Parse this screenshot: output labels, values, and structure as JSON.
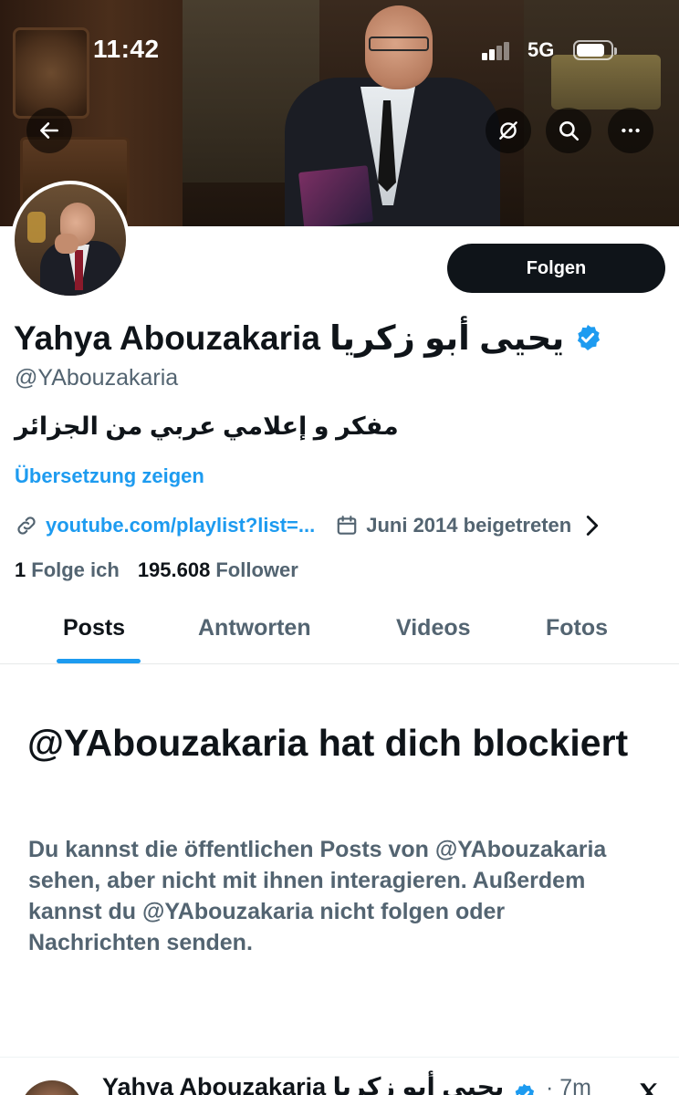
{
  "status_bar": {
    "time": "11:42",
    "network": "5G"
  },
  "banner": {
    "description_icons": [
      "back-arrow-icon",
      "hide-icon",
      "search-icon",
      "more-icon"
    ]
  },
  "profile": {
    "display_name": "Yahya Abouzakaria يحيى أبو زكريا",
    "handle": "@YAbouzakaria",
    "bio": "مفكر و إعلامي عربي من الجزائر",
    "translate_label": "Übersetzung zeigen",
    "link": "youtube.com/playlist?list=...",
    "joined": "Juni 2014 beigetreten",
    "following_count": "1",
    "following_label": "Folge ich",
    "followers_count": "195.608",
    "followers_label": "Follower",
    "follow_button": "Folgen",
    "verified_color": "#1d9bf0"
  },
  "tabs": [
    {
      "label": "Posts",
      "active": true
    },
    {
      "label": "Antworten",
      "active": false
    },
    {
      "label": "Videos",
      "active": false
    },
    {
      "label": "Fotos",
      "active": false
    }
  ],
  "blocked": {
    "title": "@YAbouzakaria hat dich blockiert",
    "message": "Du kannst die öffentlichen Posts von @YAbouzakaria sehen, aber nicht mit ihnen interagieren. Außerdem kannst du @YAbouzakaria nicht folgen oder Nachrichten senden."
  },
  "next_post": {
    "name": "Yahya Abouzakaria يحيى أبو زكريا",
    "time": "· 7m"
  },
  "colors": {
    "accent": "#1d9bf0",
    "text_primary": "#0f1419",
    "text_secondary": "#536471"
  }
}
